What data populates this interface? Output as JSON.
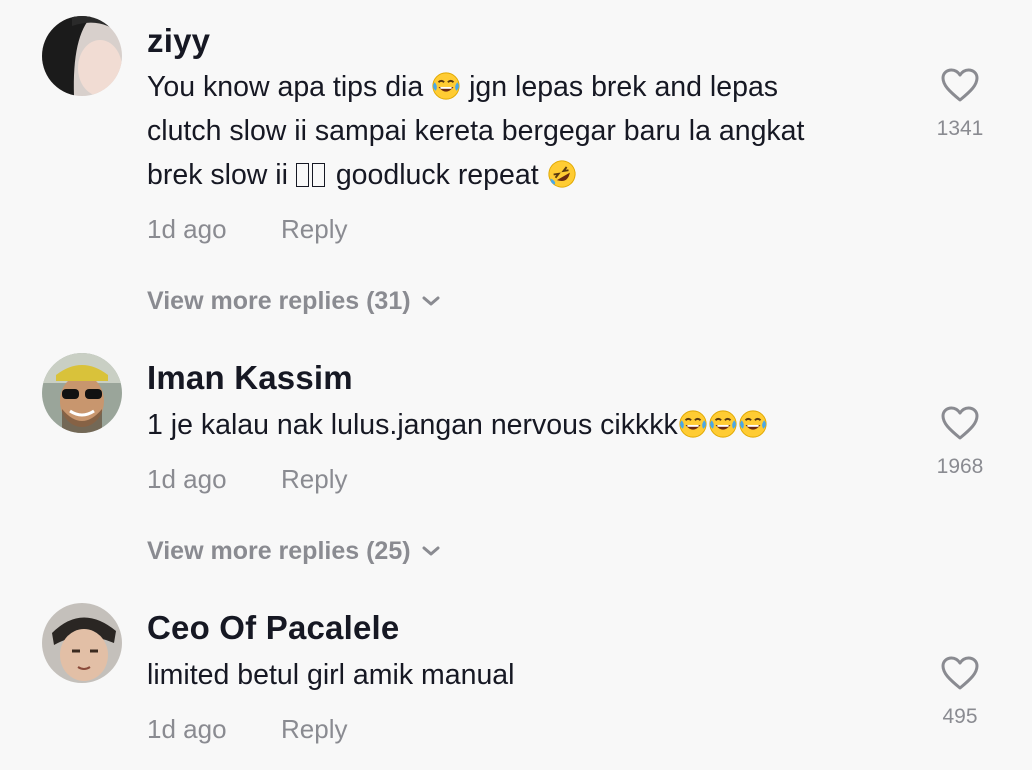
{
  "comments": [
    {
      "username": "ziyy",
      "text_parts": [
        "You know apa tips dia",
        "jgn lepas brek and lepas",
        "clutch slow ii sampai kereta bergegar baru la angkat",
        "brek slow ii",
        "goodluck repeat"
      ],
      "emojis": [
        "face-with-tears-of-joy",
        "rolling-on-floor-laughing"
      ],
      "time": "1d ago",
      "reply_label": "Reply",
      "likes": "1341",
      "view_more": "View more replies (31)"
    },
    {
      "username": "Iman Kassim",
      "text_parts": [
        "1 je kalau nak lulus.jangan nervous cikkkk"
      ],
      "emojis": [
        "face-with-tears-of-joy",
        "face-with-tears-of-joy",
        "face-with-tears-of-joy"
      ],
      "time": "1d ago",
      "reply_label": "Reply",
      "likes": "1968",
      "view_more": "View more replies (25)"
    },
    {
      "username": "Ceo Of Pacalele",
      "text_parts": [
        "limited betul girl amik manual"
      ],
      "time": "1d ago",
      "reply_label": "Reply",
      "likes": "495"
    }
  ],
  "colors": {
    "background": "#f8f8f8",
    "primary_text": "#161823",
    "secondary_text": "#8a8b91",
    "emoji_yellow": "#ffcc33",
    "tear_blue": "#4aa8e8"
  }
}
